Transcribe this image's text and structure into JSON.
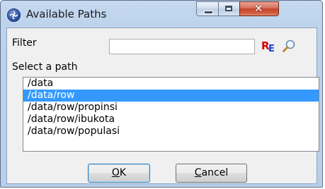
{
  "window": {
    "title": "Available Paths",
    "icon": "app-logo-icon",
    "controls": [
      "minimize-icon",
      "maximize-icon",
      "close-icon"
    ]
  },
  "filter": {
    "label": "Filter",
    "value": "",
    "regex_icon_text_r": "R",
    "regex_icon_text_e": "E",
    "search_icon": "magnifier-icon"
  },
  "select_path": {
    "label": "Select a path",
    "items": [
      {
        "label": "/data",
        "selected": false
      },
      {
        "label": "/data/row",
        "selected": true
      },
      {
        "label": "/data/row/propinsi",
        "selected": false
      },
      {
        "label": "/data/row/ibukota",
        "selected": false
      },
      {
        "label": "/data/row/populasi",
        "selected": false
      }
    ]
  },
  "buttons": {
    "ok": {
      "mnemonic": "O",
      "rest": "K"
    },
    "cancel": {
      "mnemonic": "C",
      "rest": "ancel"
    }
  },
  "colors": {
    "selection": "#3399ff",
    "regex_r": "#d40000",
    "regex_e": "#1844d8"
  }
}
